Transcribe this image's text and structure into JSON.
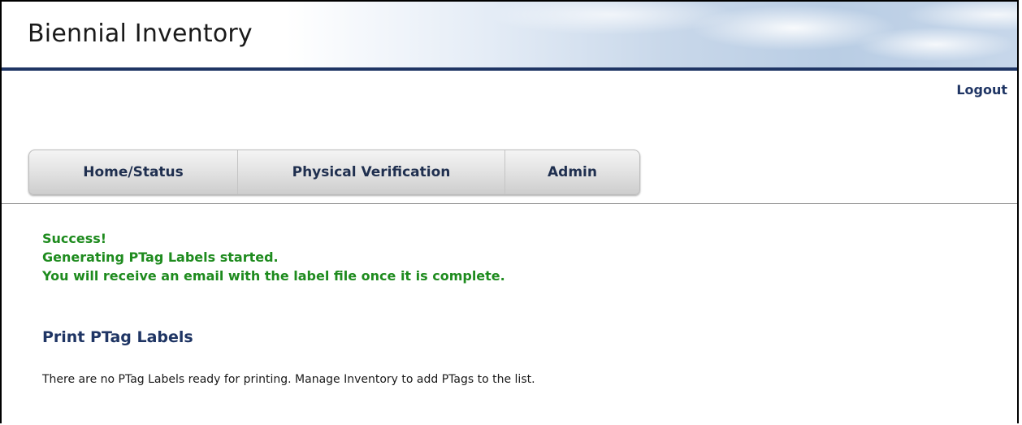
{
  "header": {
    "title": "Biennial Inventory"
  },
  "user_menu": {
    "logout_label": "Logout"
  },
  "nav": {
    "tabs": [
      {
        "label": "Home/Status"
      },
      {
        "label": "Physical Verification"
      },
      {
        "label": "Admin"
      }
    ]
  },
  "messages": {
    "lines": [
      "Success!",
      "Generating PTag Labels started.",
      "You will receive an email with the label file once it is complete."
    ],
    "color": "#1e8b1e"
  },
  "print_section": {
    "heading": "Print PTag Labels",
    "info": "There are no PTag Labels ready for printing. Manage Inventory to add PTags to the list."
  },
  "colors": {
    "brand_navy": "#1f3564",
    "success_green": "#1e8b1e"
  }
}
